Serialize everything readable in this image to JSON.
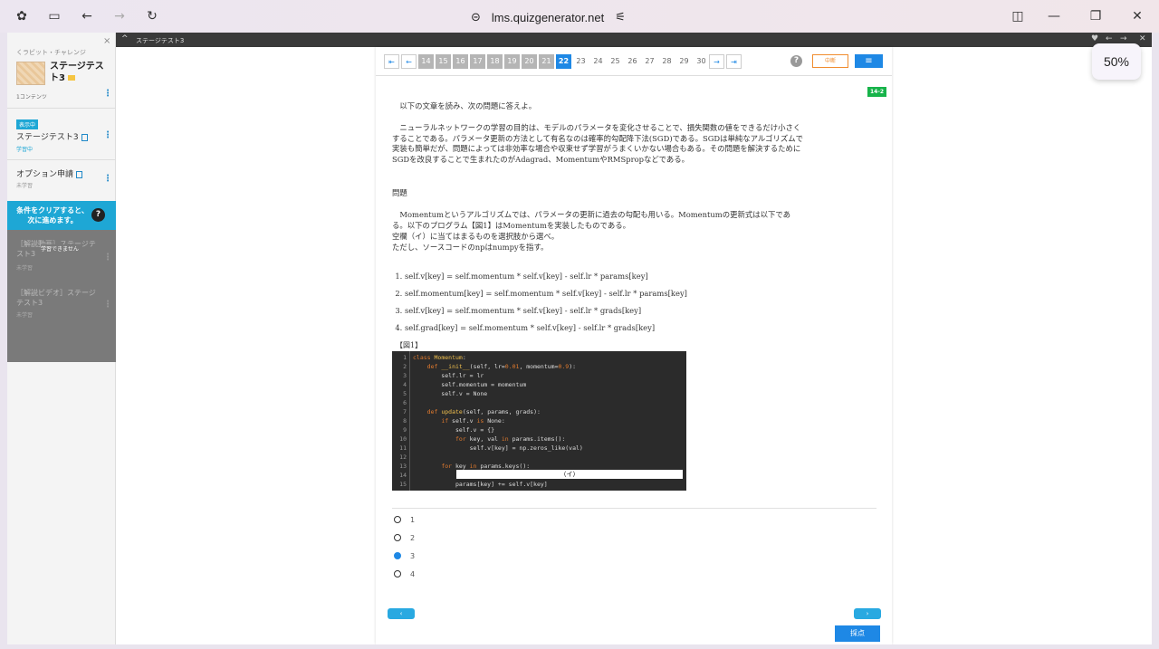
{
  "browser": {
    "url": "lms.quizgenerator.net"
  },
  "sidebar": {
    "close": "×",
    "breadcrumb": "くラビット・チャレンジ",
    "title": "ステージテスト3",
    "content_count": "1コンテンツ",
    "show_badge": "表示中",
    "items": [
      {
        "title": "ステージテスト3",
        "status": "学習中",
        "status_color": "#1ea7d5"
      },
      {
        "title": "オプション申請",
        "status": "未学習",
        "status_color": "#999999"
      }
    ],
    "condition_text": "条件をクリアすると、次に進めます。",
    "condition_help": "?",
    "locked_message": "学習できません",
    "locked_items": [
      {
        "title": "［解説動画］ステージテスト3",
        "status": "未学習"
      },
      {
        "title": "［解説ビデオ］ステージテスト3",
        "status": "未学習"
      }
    ]
  },
  "topbar": {
    "title": "ステージテスト3"
  },
  "pager": {
    "pages": [
      "14",
      "15",
      "16",
      "17",
      "18",
      "19",
      "20",
      "21",
      "22",
      "23",
      "24",
      "25",
      "26",
      "27",
      "28",
      "29",
      "30"
    ],
    "current": "22",
    "help": "?",
    "stop_label": "中断",
    "menu_label": "≡"
  },
  "question": {
    "tag": "14-2",
    "intro": "以下の文章を読み、次の問題に答えよ。",
    "passage": "ニューラルネットワークの学習の目的は、モデルのパラメータを変化させることで、損失関数の値をできるだけ小さくすることである。パラメータ更新の方法として有名なのは確率的勾配降下法(SGD)である。SGDは単純なアルゴリズムで実装も簡単だが、問題によっては非効率な場合や収束せず学習がうまくいかない場合もある。その問題を解決するためにSGDを改良することで生まれたのがAdagrad、MomentumやRMSpropなどである。",
    "heading": "問題",
    "problem": "Momentumというアルゴリズムでは、パラメータの更新に過去の勾配も用いる。Momentumの更新式は以下である。以下のプログラム【図1】はMomentumを実装したものである。",
    "problem2": "空欄（イ）に当てはまるものを選択肢から選べ。",
    "problem3": "ただし、ソースコードのnpはnumpyを指す。",
    "options": [
      "self.v[key] = self.momentum * self.v[key] - self.lr * params[key]",
      "self.momentum[key] = self.momentum * self.v[key] - self.lr * params[key]",
      "self.v[key] = self.momentum * self.v[key] - self.lr * grads[key]",
      "self.grad[key] = self.momentum * self.v[key] - self.lr * grads[key]"
    ],
    "figure_label": "【図1】",
    "blank_label": "（イ）"
  },
  "answers": {
    "choices": [
      "1",
      "2",
      "3",
      "4"
    ],
    "selected_index": 2
  },
  "nav": {
    "prev": "‹",
    "next": "›",
    "submit": "採点"
  },
  "zoom": "50%"
}
